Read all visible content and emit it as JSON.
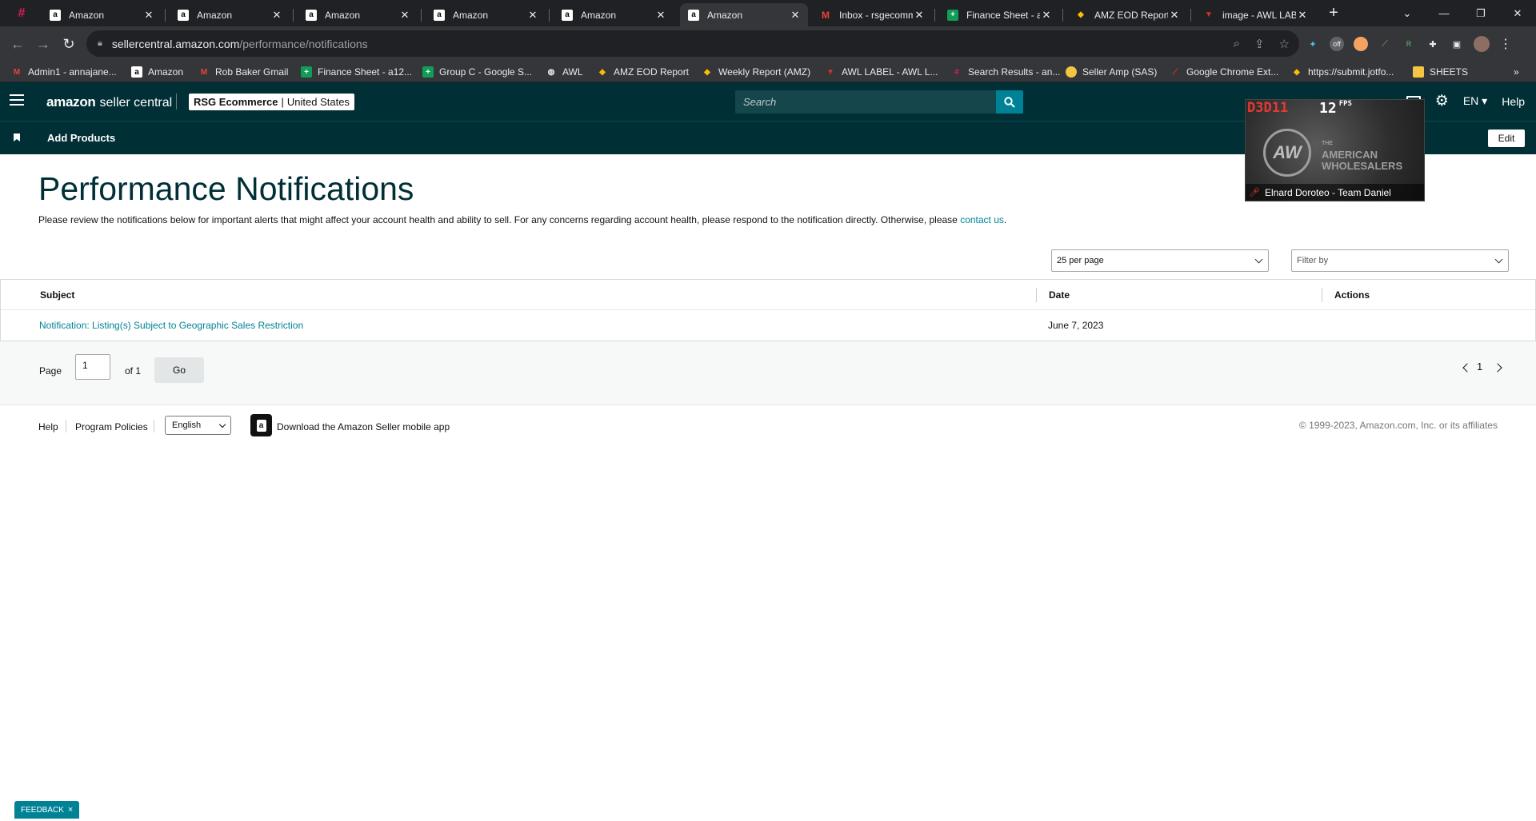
{
  "browser": {
    "tabs": [
      {
        "title": "Amazon",
        "favicon": "amazon-icon"
      },
      {
        "title": "Amazon",
        "favicon": "amazon-icon"
      },
      {
        "title": "Amazon",
        "favicon": "amazon-icon"
      },
      {
        "title": "Amazon",
        "favicon": "amazon-icon"
      },
      {
        "title": "Amazon",
        "favicon": "amazon-icon"
      },
      {
        "title": "Amazon",
        "favicon": "amazon-icon",
        "active": true
      },
      {
        "title": "Inbox - rsgecomm",
        "favicon": "gmail-icon"
      },
      {
        "title": "Finance Sheet - a",
        "favicon": "sheets-icon"
      },
      {
        "title": "AMZ EOD Report",
        "favicon": "report-icon"
      },
      {
        "title": "image - AWL LAB",
        "favicon": "awl-icon"
      }
    ],
    "url_domain": "sellercentral.amazon.com",
    "url_path": "/performance/notifications",
    "bookmarks": [
      {
        "label": "Admin1 - annajane..."
      },
      {
        "label": "Amazon"
      },
      {
        "label": "Rob Baker Gmail"
      },
      {
        "label": "Finance Sheet - a12..."
      },
      {
        "label": "Group C - Google S..."
      },
      {
        "label": "AWL"
      },
      {
        "label": "AMZ EOD Report"
      },
      {
        "label": "Weekly Report (AMZ)"
      },
      {
        "label": "AWL LABEL - AWL L..."
      },
      {
        "label": "Search Results - an..."
      },
      {
        "label": "Seller Amp (SAS)"
      },
      {
        "label": "Google Chrome Ext..."
      },
      {
        "label": "https://submit.jotfo..."
      },
      {
        "label": "SHEETS"
      }
    ],
    "bookmarks_more": "»"
  },
  "header": {
    "logo_amazon": "amazon",
    "logo_seller_central": "seller central",
    "store_name": "RSG Ecommerce",
    "store_divider": "|",
    "store_region": "United States",
    "search_placeholder": "Search",
    "language": "EN",
    "help": "Help"
  },
  "subnav": {
    "add_products": "Add Products",
    "edit": "Edit"
  },
  "overlay": {
    "api_label": "D3D11",
    "fps_value": "12",
    "fps_label": "FPS",
    "logo_letters": "AW",
    "brand_the": "THE",
    "brand_line1": "AMERICAN",
    "brand_line2": "WHOLESALERS",
    "caption": "Elnard Doroteo - Team Daniel"
  },
  "main": {
    "title": "Performance Notifications",
    "intro_text": "Please review the notifications below for important alerts that might affect your account health and ability to sell. For any concerns regarding account health, please respond to the notification directly. Otherwise, please ",
    "intro_link": "contact us",
    "intro_end": ".",
    "per_page": "25 per page",
    "filter_placeholder": "Filter by",
    "table": {
      "columns": [
        "Subject",
        "Date",
        "Actions"
      ],
      "rows": [
        {
          "subject": "Notification: Listing(s) Subject to Geographic Sales Restriction",
          "date": "June 7, 2023",
          "actions": ""
        }
      ]
    },
    "pager": {
      "page_label": "Page",
      "page_value": "1",
      "of_label": "of 1",
      "go": "Go",
      "current": "1"
    }
  },
  "footer": {
    "help": "Help",
    "program_policies": "Program Policies",
    "language": "English",
    "app_text": "Download the Amazon Seller mobile app",
    "copyright": "© 1999-2023, Amazon.com, Inc. or its affiliates"
  },
  "feedback": {
    "label": "FEEDBACK",
    "close": "×"
  },
  "colors": {
    "header_bg": "#002f36",
    "accent": "#008296",
    "link": "#008296"
  }
}
